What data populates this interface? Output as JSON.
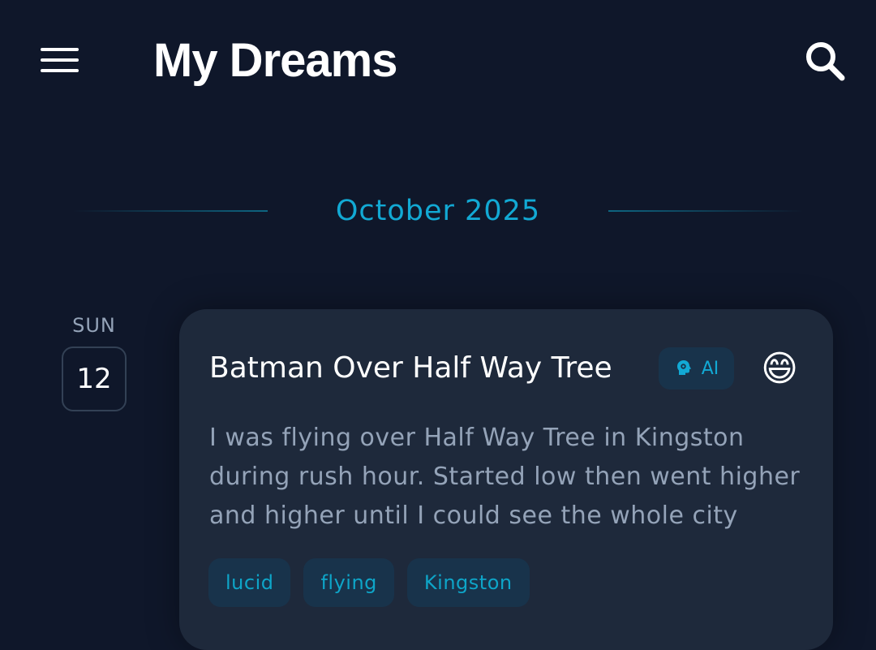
{
  "header": {
    "title": "My Dreams",
    "menu_icon": "menu-icon",
    "search_icon": "search-icon"
  },
  "month_header": {
    "label": "October 2025"
  },
  "entries": [
    {
      "weekday": "SUN",
      "day": "12",
      "title": "Batman Over Half Way Tree",
      "ai_badge": "AI",
      "ai_icon": "brain-gear-icon",
      "mood_emoji": "😄",
      "excerpt": "I was flying over Half Way Tree in Kingston during rush hour. Started low then went higher and higher until I could see the whole city",
      "tags": [
        "lucid",
        "flying",
        "Kingston"
      ]
    }
  ],
  "colors": {
    "background": "#0f172a",
    "card": "#1e293b",
    "accent": "#12a9d4",
    "tag_bg": "#18334b",
    "muted_text": "#94a3b8"
  }
}
